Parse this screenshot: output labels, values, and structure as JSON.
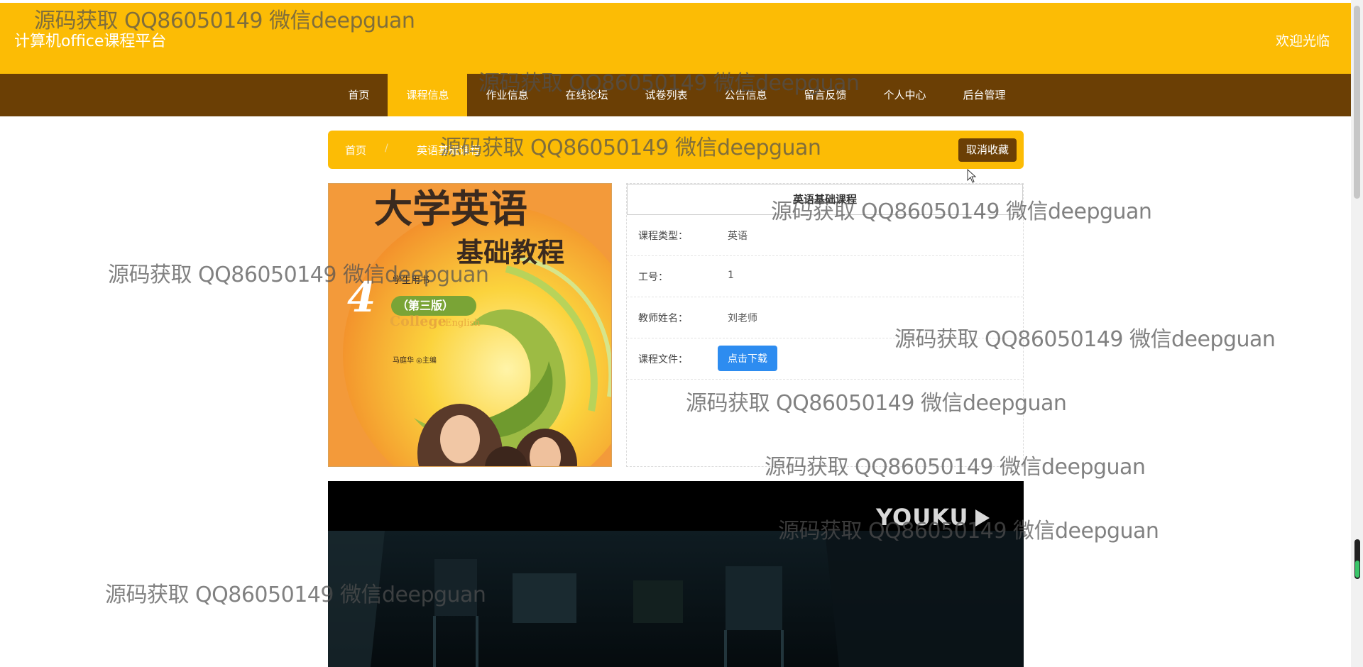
{
  "header": {
    "site_title": "计算机office课程平台",
    "welcome": "欢迎光临"
  },
  "nav": {
    "items": [
      {
        "label": "首页"
      },
      {
        "label": "课程信息"
      },
      {
        "label": "作业信息"
      },
      {
        "label": "在线论坛"
      },
      {
        "label": "试卷列表"
      },
      {
        "label": "公告信息"
      },
      {
        "label": "留言反馈"
      },
      {
        "label": "个人中心"
      },
      {
        "label": "后台管理"
      }
    ],
    "active_index": 1
  },
  "breadcrumb": {
    "home": "首页",
    "separator": "/",
    "current": "英语基础课程"
  },
  "cancel_favorite_label": "取消收藏",
  "cover": {
    "title_line1": "大学英语",
    "title_line2": "基础教程",
    "volume": "4",
    "subtitle": "学生用书",
    "edition": "（第三版）",
    "series_word1": "College",
    "series_word2": "English",
    "author": "马庭华  ◎主编"
  },
  "course": {
    "name": "英语基础课程",
    "type_label": "课程类型：",
    "type_value": "英语",
    "id_label": "工号：",
    "id_value": "1",
    "teacher_label": "教师姓名：",
    "teacher_value": "刘老师",
    "file_label": "课程文件：",
    "download_label": "点击下载"
  },
  "video": {
    "logo": "YOUKU"
  },
  "watermark_text": "源码获取 QQ86050149 微信deepguan",
  "colors": {
    "header_yellow": "#fcbc05",
    "nav_brown": "#6b3f05",
    "download_blue": "#2d8cf0"
  }
}
